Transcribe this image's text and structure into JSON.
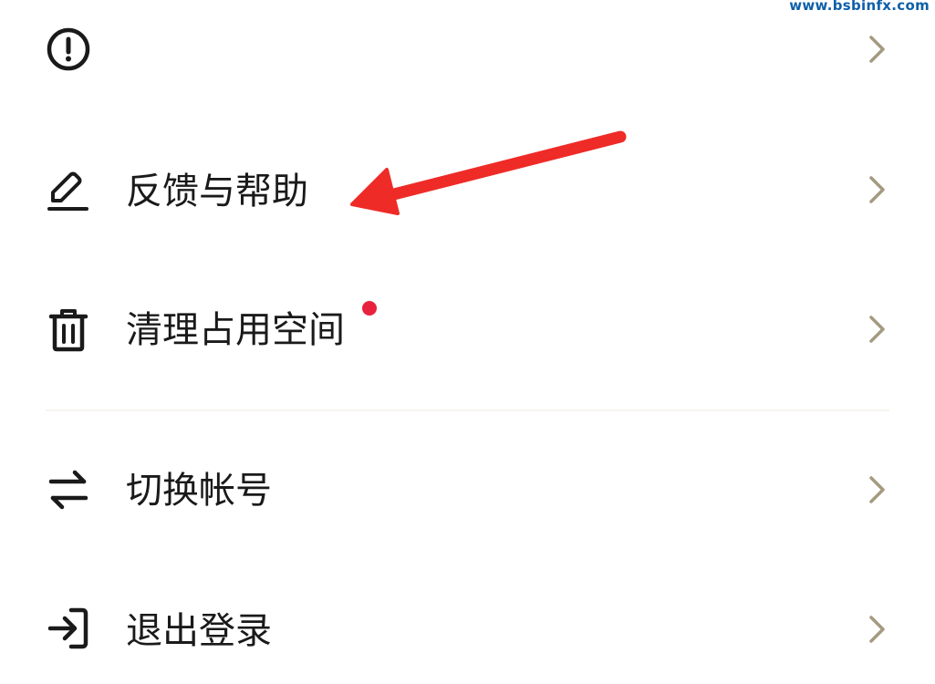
{
  "watermark": "www.bsbinfx.com",
  "colors": {
    "text": "#1a1a1a",
    "icon": "#1a1a1a",
    "chevron": "#a49a80",
    "badge": "#e8223d",
    "annotation_arrow": "#ee2b27",
    "watermark": "#0f5fa8"
  },
  "menu": {
    "items": [
      {
        "icon": "alert-circle-icon",
        "label": ""
      },
      {
        "icon": "pencil-edit-icon",
        "label": "反馈与帮助"
      },
      {
        "icon": "trash-icon",
        "label": "清理占用空间",
        "badge": "red-dot"
      },
      {
        "icon": "swap-arrows-icon",
        "label": "切换帐号"
      },
      {
        "icon": "logout-icon",
        "label": "退出登录"
      }
    ]
  }
}
